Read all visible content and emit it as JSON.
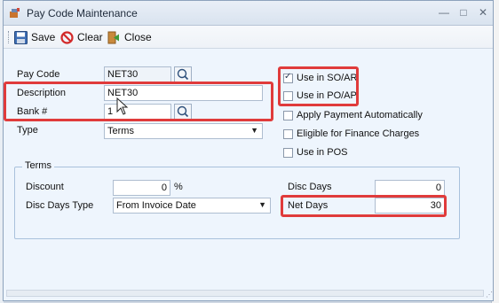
{
  "window": {
    "title": "Pay Code Maintenance",
    "minimize_glyph": "—",
    "maximize_glyph": "□",
    "close_glyph": "✕"
  },
  "toolbar": {
    "save_label": "Save",
    "clear_label": "Clear",
    "close_label": "Close"
  },
  "form": {
    "pay_code_label": "Pay Code",
    "pay_code_value": "NET30",
    "description_label": "Description",
    "description_value": "NET30",
    "bank_label": "Bank #",
    "bank_value": "1",
    "type_label": "Type",
    "type_value": "Terms"
  },
  "options": {
    "use_in_so_ar": {
      "label": "Use in SO/AR",
      "checked": true
    },
    "use_in_po_ap": {
      "label": "Use in PO/AP",
      "checked": false
    },
    "apply_payment_automatically": {
      "label": "Apply Payment Automatically",
      "checked": false
    },
    "eligible_for_finance_charges": {
      "label": "Eligible for Finance Charges",
      "checked": false
    },
    "use_in_pos": {
      "label": "Use in POS",
      "checked": false
    }
  },
  "terms": {
    "group_label": "Terms",
    "discount_label": "Discount",
    "discount_value": "0",
    "discount_unit": "%",
    "disc_days_type_label": "Disc Days Type",
    "disc_days_type_value": "From Invoice Date",
    "disc_days_label": "Disc Days",
    "disc_days_value": "0",
    "net_days_label": "Net Days",
    "net_days_value": "30"
  },
  "colors": {
    "highlight": "#e03b3b",
    "title_bar": "#dde6f1",
    "form_background": "#eef5fd"
  },
  "icons": {
    "app": "app-icon",
    "save": "save-icon",
    "clear": "clear-icon",
    "close": "close-door-icon",
    "lookup": "search-icon",
    "dropdown": "chevron-down-icon"
  }
}
